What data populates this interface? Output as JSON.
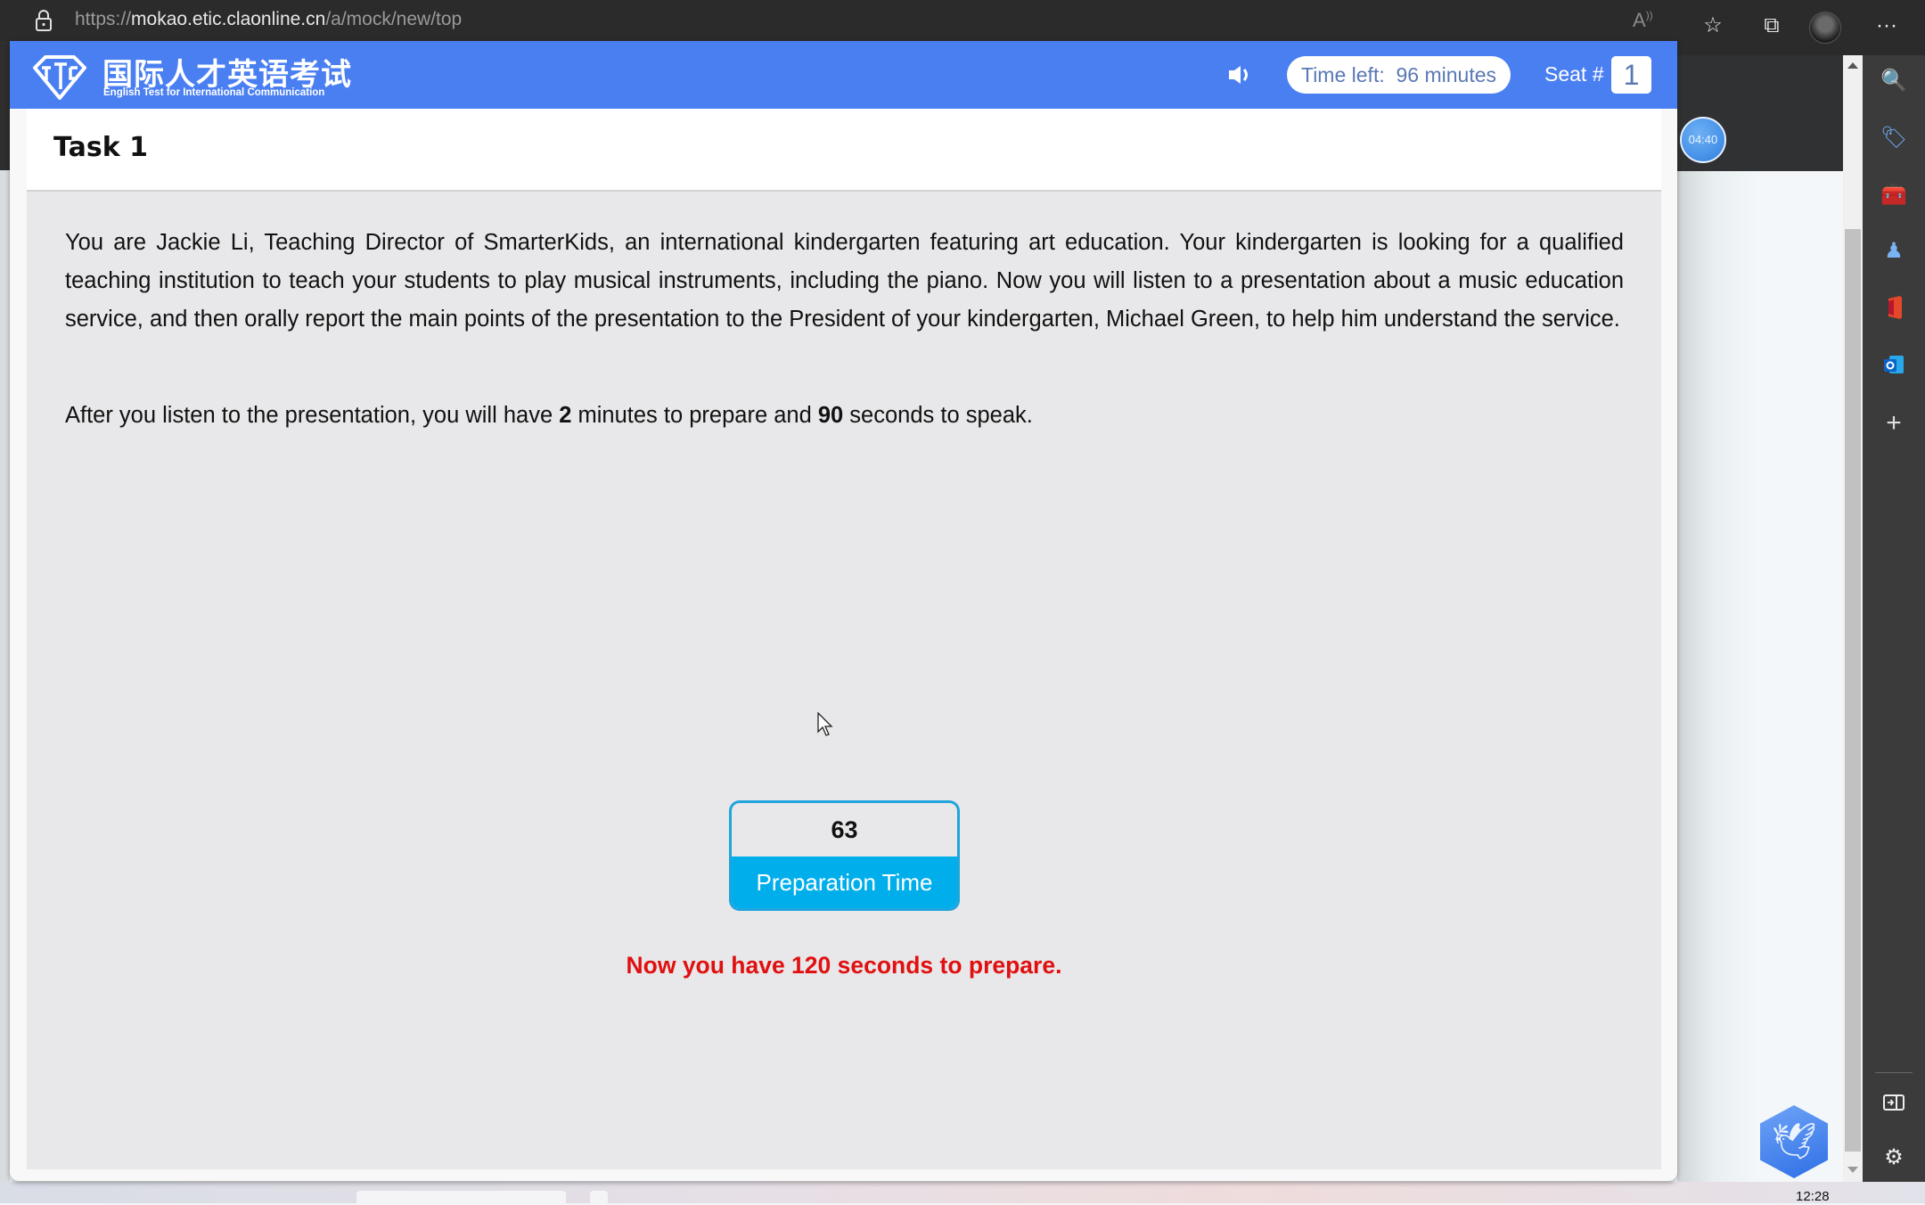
{
  "browser": {
    "url_scheme": "https://",
    "url_host": "mokao.etic.claonline.cn",
    "url_path": "/a/mock/new/top",
    "toolbar_icons": [
      "read-aloud-icon",
      "favorites-icon",
      "collections-icon",
      "profile-avatar",
      "more-icon"
    ],
    "more_label": "···"
  },
  "behind_page": {
    "timer_bubble": "04:40"
  },
  "edge_sidebar": {
    "icons": [
      "search-icon",
      "shopping-tag-icon",
      "tools-icon",
      "games-icon",
      "office-icon",
      "outlook-icon",
      "add-icon",
      "split-screen-icon",
      "settings-icon"
    ]
  },
  "exam": {
    "header": {
      "logo_cn": "国际人才英语考试",
      "logo_en": "English Test for International Communication",
      "time_left_label": "Time left:",
      "time_left_value": "96 minutes",
      "seat_label": "Seat #",
      "seat_number": "1"
    },
    "task": {
      "title": "Task 1",
      "paragraph1": "You are Jackie Li, Teaching Director of SmarterKids, an international kindergarten featuring art education. Your kindergarten is looking for a qualified teaching institution to teach your students to play musical instruments, including the piano. Now you will listen to a presentation about a music education service, and then orally report the main points of the presentation to the President of your kindergarten, Michael Green, to help him understand the service.",
      "paragraph2_part1": "After you listen to the presentation, you will have ",
      "prepare_minutes": "2",
      "paragraph2_part2": " minutes to prepare and ",
      "speak_seconds": "90",
      "paragraph2_part3": " seconds to speak."
    },
    "preparation": {
      "countdown": "63",
      "label": "Preparation Time",
      "notice": "Now you have 120 seconds to prepare."
    }
  },
  "taskbar": {
    "clock": "12:28"
  },
  "colors": {
    "header_blue": "#4a7ff2",
    "prep_blue": "#00aeec",
    "notice_red": "#e01010",
    "content_gray": "#e8e7e9"
  }
}
